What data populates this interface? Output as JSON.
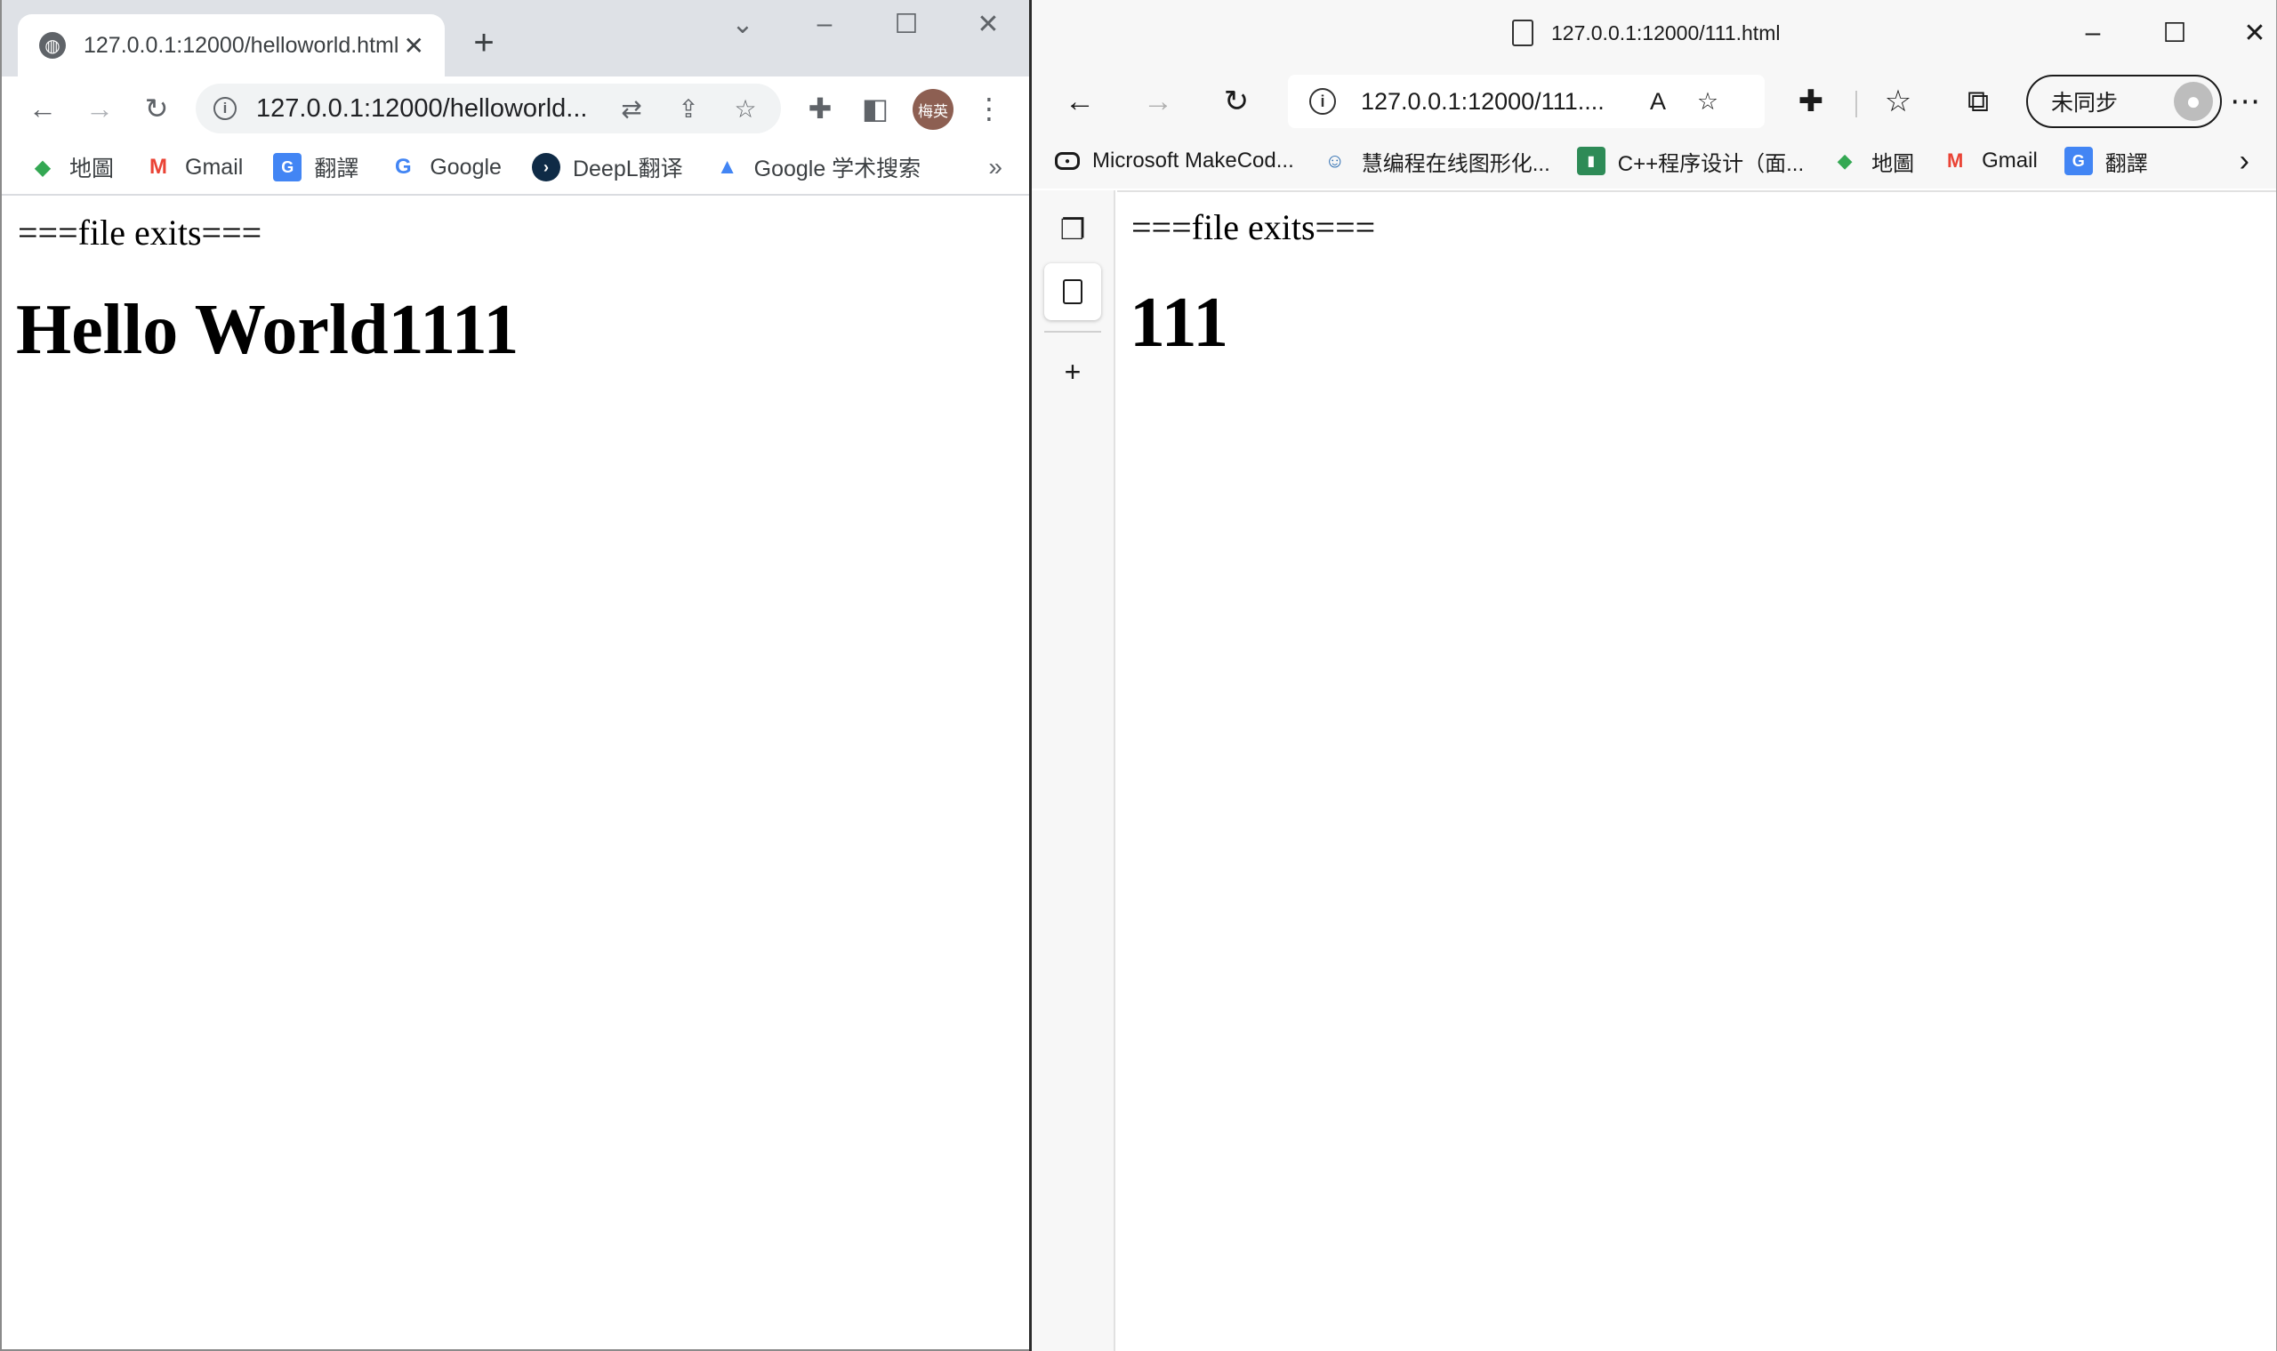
{
  "chrome": {
    "tab": {
      "title": "127.0.0.1:12000/helloworld.html",
      "favicon": "globe-icon"
    },
    "omnibox": {
      "url": "127.0.0.1:12000/helloworld..."
    },
    "avatar": {
      "label": "梅英",
      "color": "#8d5f52"
    },
    "bookmarks": [
      {
        "label": "地圖",
        "icon": "maps-icon"
      },
      {
        "label": "Gmail",
        "icon": "gmail-icon"
      },
      {
        "label": "翻譯",
        "icon": "translate-icon"
      },
      {
        "label": "Google",
        "icon": "google-icon"
      },
      {
        "label": "DeepL翻译",
        "icon": "deepl-icon"
      },
      {
        "label": "Google 学术搜索",
        "icon": "scholar-icon"
      }
    ],
    "bookmarks_more": "»",
    "page": {
      "line": "===file exits===",
      "heading": "Hello World1111"
    }
  },
  "edge": {
    "window_title": "127.0.0.1:12000/111.html",
    "address": {
      "url": "127.0.0.1:12000/111...."
    },
    "sync": {
      "label": "未同步"
    },
    "bookmarks": [
      {
        "label": "Microsoft MakeCod...",
        "icon": "makecode-icon"
      },
      {
        "label": "慧编程在线图形化...",
        "icon": "mblock-icon"
      },
      {
        "label": "C++程序设计（面...",
        "icon": "book-icon"
      },
      {
        "label": "地圖",
        "icon": "maps-icon"
      },
      {
        "label": "Gmail",
        "icon": "gmail-icon"
      },
      {
        "label": "翻譯",
        "icon": "translate-icon"
      }
    ],
    "page": {
      "line": "===file exits===",
      "heading": "111"
    }
  }
}
